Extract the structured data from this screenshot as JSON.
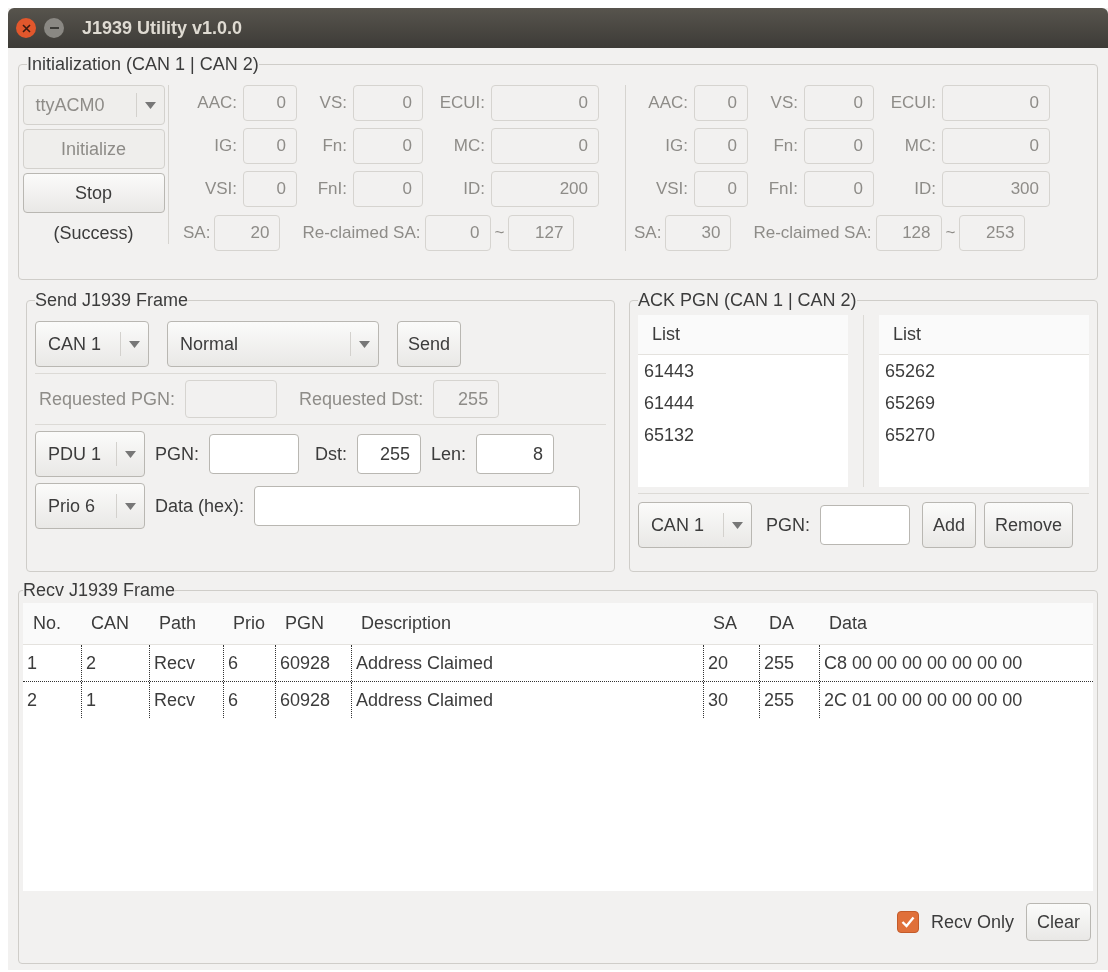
{
  "window": {
    "title": "J1939 Utility v1.0.0"
  },
  "initialization": {
    "title": "Initialization  (CAN 1 | CAN 2)",
    "port": {
      "value": "ttyACM0",
      "disabled": true
    },
    "buttons": [
      {
        "label": "Initialize",
        "disabled": true
      },
      {
        "label": "Stop",
        "disabled": false
      }
    ],
    "status": "(Success)",
    "channels": [
      {
        "disabled": true,
        "fields": [
          {
            "label": "AAC:",
            "value": "0"
          },
          {
            "label": "VS:",
            "value": "0"
          },
          {
            "label": "ECUI:",
            "value": "0"
          },
          {
            "label": "IG:",
            "value": "0"
          },
          {
            "label": "Fn:",
            "value": "0"
          },
          {
            "label": "MC:",
            "value": "0"
          },
          {
            "label": "VSI:",
            "value": "0"
          },
          {
            "label": "FnI:",
            "value": "0"
          },
          {
            "label": "ID:",
            "value": "200"
          }
        ],
        "sa_label": "SA:",
        "sa": "20",
        "reclaimed_label": "Re-claimed SA:",
        "reclaimed_from": "0",
        "range_sign": "~",
        "reclaimed_to": "127"
      },
      {
        "disabled": true,
        "fields": [
          {
            "label": "AAC:",
            "value": "0"
          },
          {
            "label": "VS:",
            "value": "0"
          },
          {
            "label": "ECUI:",
            "value": "0"
          },
          {
            "label": "IG:",
            "value": "0"
          },
          {
            "label": "Fn:",
            "value": "0"
          },
          {
            "label": "MC:",
            "value": "0"
          },
          {
            "label": "VSI:",
            "value": "0"
          },
          {
            "label": "FnI:",
            "value": "0"
          },
          {
            "label": "ID:",
            "value": "300"
          }
        ],
        "sa_label": "SA:",
        "sa": "30",
        "reclaimed_label": "Re-claimed SA:",
        "reclaimed_from": "128",
        "range_sign": "~",
        "reclaimed_to": "253"
      }
    ]
  },
  "send_frame": {
    "title": "Send J1939 Frame",
    "can": "CAN 1",
    "mode": "Normal",
    "send_button": "Send",
    "request": {
      "disabled": true,
      "pgn_label": "Requested PGN:",
      "dst_label": "Requested Dst:",
      "dst": "255"
    },
    "pdu": "PDU 1",
    "pgn_label": "PGN:",
    "dst_label": "Dst:",
    "dst": "255",
    "len_label": "Len:",
    "len": "8",
    "prio": "Prio 6",
    "data_label": "Data (hex):"
  },
  "ack_pgn": {
    "title": "ACK PGN  (CAN 1 | CAN 2)",
    "lists": [
      {
        "header": "List",
        "items": [
          "61443",
          "61444",
          "65132"
        ]
      },
      {
        "header": "List",
        "items": [
          "65262",
          "65269",
          "65270"
        ]
      }
    ],
    "can": "CAN 1",
    "pgn_label": "PGN:",
    "buttons": [
      "Add",
      "Remove"
    ]
  },
  "recv_frame": {
    "title": "Recv J1939 Frame",
    "columns": [
      "No.",
      "CAN",
      "Path",
      "Prio",
      "PGN",
      "Description",
      "SA",
      "DA",
      "Data"
    ],
    "rows": [
      [
        "1",
        "2",
        "Recv",
        "6",
        "60928",
        "Address Claimed",
        "20",
        "255",
        "C8 00 00 00 00 00 00 00"
      ],
      [
        "2",
        "1",
        "Recv",
        "6",
        "60928",
        "Address Claimed",
        "30",
        "255",
        "2C 01 00 00 00 00 00 00"
      ]
    ],
    "recv_only": {
      "label": "Recv Only",
      "checked": true
    },
    "clear_button": "Clear"
  }
}
